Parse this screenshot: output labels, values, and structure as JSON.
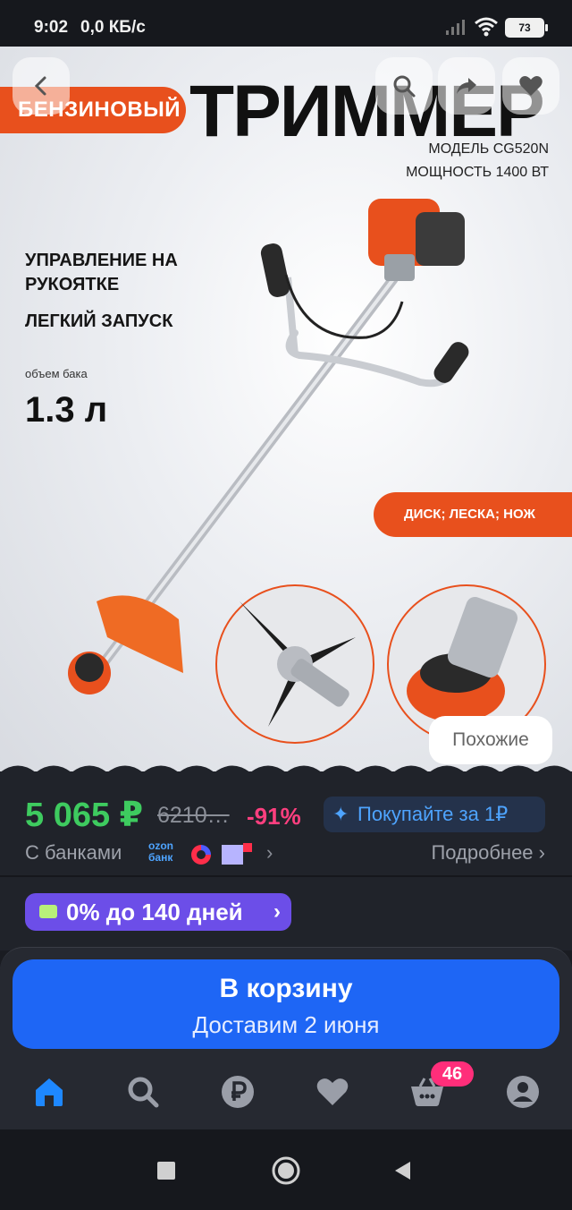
{
  "status_bar": {
    "time": "9:02",
    "network_speed": "0,0 КБ/с",
    "battery": "73",
    "icons": [
      "signal-icon",
      "wifi-icon",
      "battery-icon"
    ]
  },
  "product_image": {
    "badge": "БЕНЗИНОВЫЙ",
    "headline": "ТРИММЕР",
    "model": "МОДЕЛЬ CG520N",
    "power": "МОЩНОСТЬ 1400 ВТ",
    "feature_1": "УПРАВЛЕНИЕ НА РУКОЯТКЕ",
    "feature_2": "ЛЕГКИЙ ЗАПУСК",
    "tank_label": "объем бака",
    "tank_value": "1.3 л",
    "attachments": "ДИСК; ЛЕСКА; НОЖ",
    "similar_button": "Похожие",
    "overlay_icons": [
      "back-icon",
      "search-icon",
      "share-icon",
      "heart-icon"
    ]
  },
  "price": {
    "current": "5 065 ₽",
    "old": "6210…",
    "discount": "-91%",
    "promo": "Покупайте за 1₽",
    "banks_label": "С банками",
    "ozon_bank": "ozon банк",
    "more": "Подробнее",
    "installment": "0% до 140 дней"
  },
  "cart": {
    "title": "В корзину",
    "delivery": "Доставим 2 июня",
    "badge_count": "46"
  },
  "tabs": [
    "home-icon",
    "search-icon",
    "ruble-icon",
    "heart-icon",
    "cart-icon",
    "profile-icon"
  ],
  "colors": {
    "accent_orange": "#e8501d",
    "price_green": "#3ecb5f",
    "discount_pink": "#ff3f7f",
    "primary_blue": "#1e66f5",
    "installment_purple": "#6c4ee8"
  }
}
